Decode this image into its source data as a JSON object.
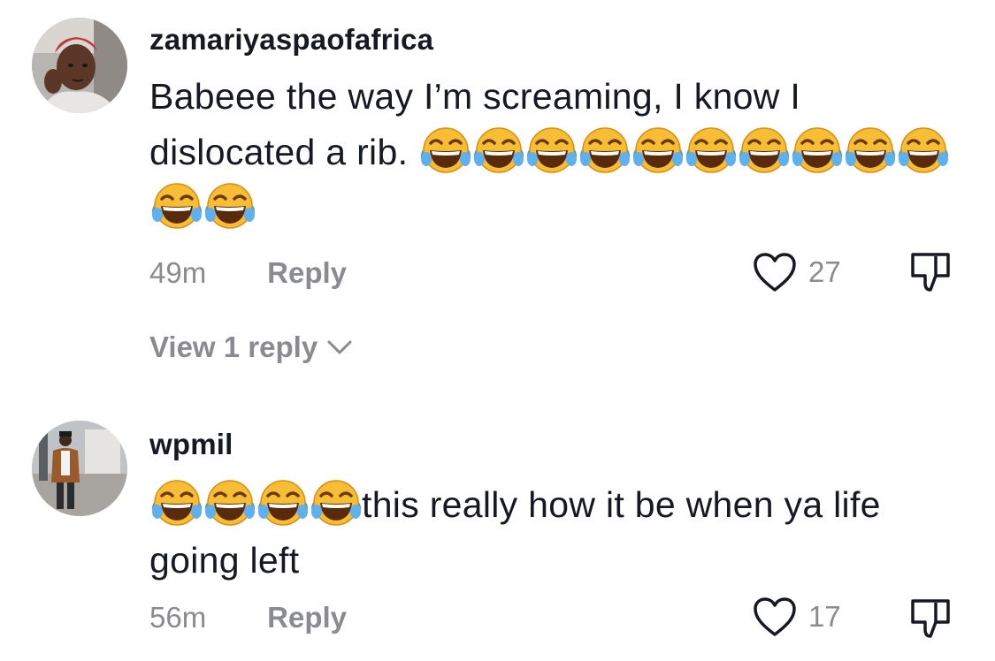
{
  "comments": [
    {
      "username": "zamariyaspaofafrica",
      "text": "Babeee the way I’m screaming, I know I dislocated a rib.",
      "emoji_after": 12,
      "time": "49m",
      "reply_label": "Reply",
      "likes": "27",
      "view_replies": "View 1 reply",
      "avatar_icon": "user-avatar-woman",
      "emoji_icon": "face-with-tears-of-joy"
    },
    {
      "username": "wpmil",
      "emoji_before": 4,
      "text": "this really how it be when ya life going left",
      "time": "56m",
      "reply_label": "Reply",
      "likes": "17",
      "avatar_icon": "user-avatar-man",
      "emoji_icon": "face-with-tears-of-joy"
    }
  ],
  "colors": {
    "text": "#161823",
    "muted": "#8a8b91",
    "background": "#ffffff",
    "emoji_face": "#f5b52b",
    "emoji_tears": "#4a9fe0"
  }
}
